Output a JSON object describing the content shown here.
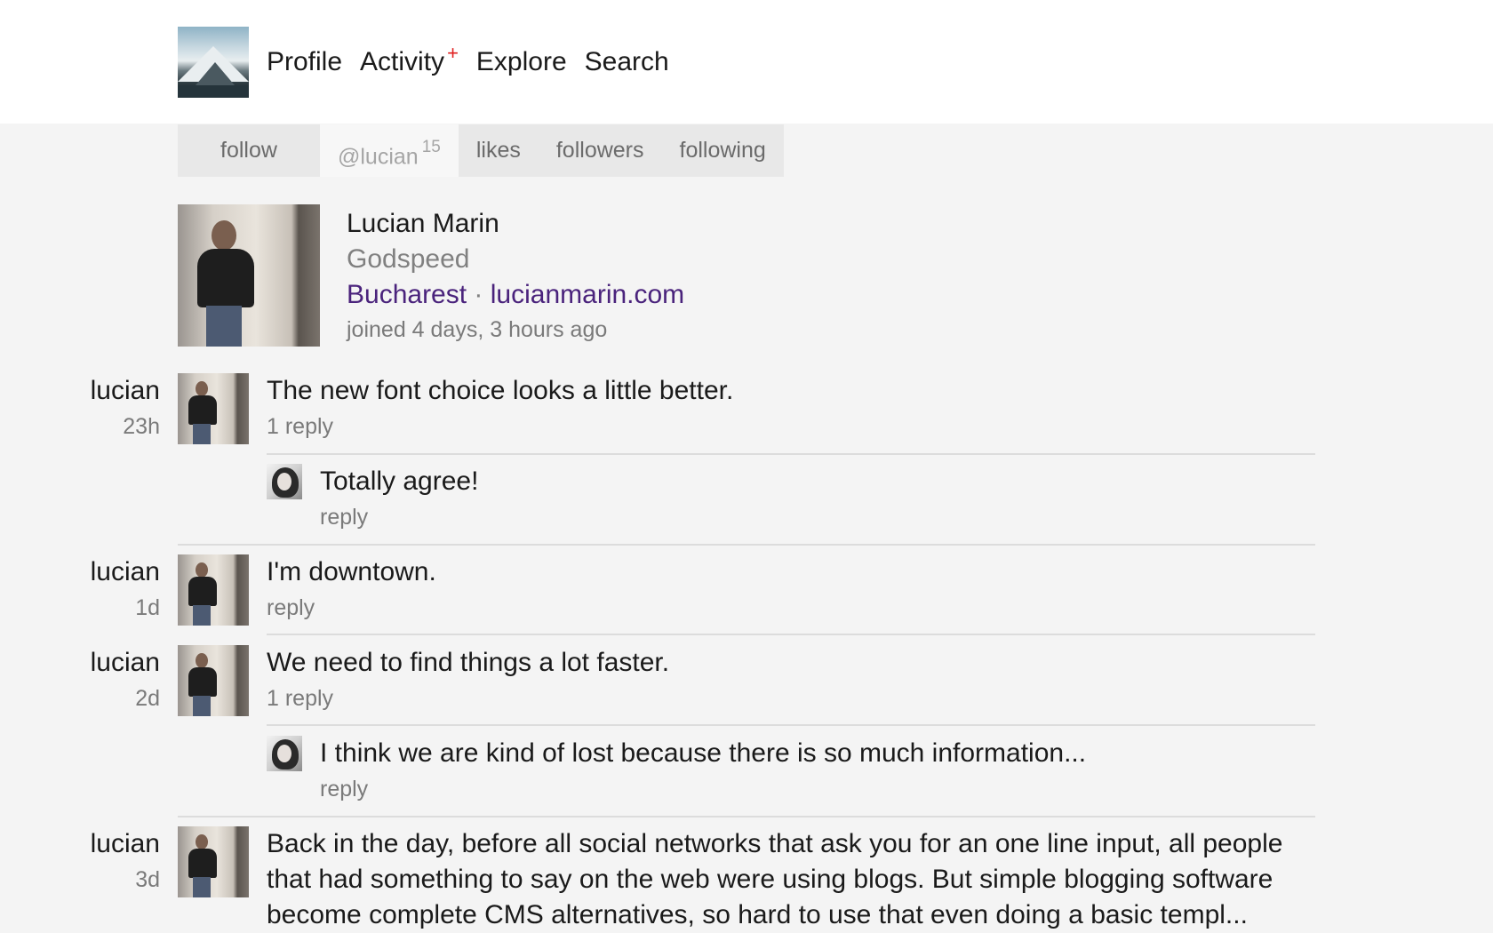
{
  "nav": {
    "logo_alt": "mountain-logo",
    "items": [
      "Profile",
      "Activity",
      "Explore",
      "Search"
    ],
    "activity_badge": "+"
  },
  "tabs": {
    "follow": "follow",
    "handle": "@lucian",
    "handle_count": "15",
    "likes": "likes",
    "followers": "followers",
    "following": "following"
  },
  "profile": {
    "name": "Lucian Marin",
    "tagline": "Godspeed",
    "location": "Bucharest",
    "separator": "·",
    "website": "lucianmarin.com",
    "joined": "joined 4 days, 3 hours ago"
  },
  "posts": [
    {
      "user": "lucian",
      "time": "23h",
      "text": "The new font choice looks a little better.",
      "meta": "1 reply",
      "reply": {
        "text": "Totally agree!",
        "meta": "reply"
      }
    },
    {
      "user": "lucian",
      "time": "1d",
      "text": "I'm downtown.",
      "meta": "reply"
    },
    {
      "user": "lucian",
      "time": "2d",
      "text": "We need to find things a lot faster.",
      "meta": "1 reply",
      "reply": {
        "text": "I think we are kind of lost because there is so much information...",
        "meta": "reply"
      }
    },
    {
      "user": "lucian",
      "time": "3d",
      "text": "Back in the day, before all social networks that ask you for an one line input, all people that had something to say on the web were using blogs. But simple blogging software become complete CMS alternatives, so hard to use that even doing a basic templ..."
    }
  ],
  "colors": {
    "accent_badge": "#e02020",
    "link": "#4a237c",
    "background": "#f4f4f4"
  }
}
